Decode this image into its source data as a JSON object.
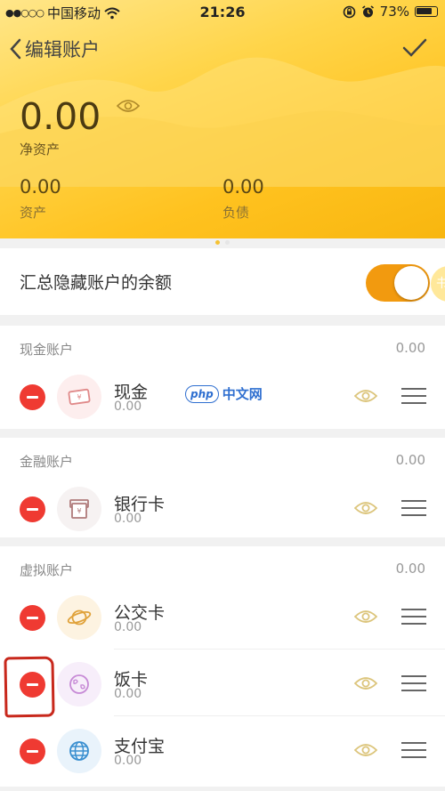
{
  "status_bar": {
    "signal": "●●○○○",
    "carrier": "中国移动",
    "time": "21:26",
    "battery_pct": "73%"
  },
  "nav": {
    "title": "编辑账户"
  },
  "summary": {
    "net_assets_value": "0.00",
    "net_assets_label": "净资产",
    "assets_value": "0.00",
    "assets_label": "资产",
    "liabilities_value": "0.00",
    "liabilities_label": "负债",
    "page_count": 2,
    "active_page": 1
  },
  "toggle": {
    "label": "汇总隐藏账户的余额",
    "on": true,
    "edge_tab_text": "书"
  },
  "sections": [
    {
      "title": "现金账户",
      "total": "0.00",
      "items": [
        {
          "name": "现金",
          "value": "0.00",
          "icon": "cash-icon",
          "icon_color": "#e08a8a",
          "icon_bg": "#fdeeee"
        }
      ]
    },
    {
      "title": "金融账户",
      "total": "0.00",
      "items": [
        {
          "name": "银行卡",
          "value": "0.00",
          "icon": "bank-card-icon",
          "icon_color": "#b07b7b",
          "icon_bg": "#f6f2f2"
        }
      ]
    },
    {
      "title": "虚拟账户",
      "total": "0.00",
      "items": [
        {
          "name": "公交卡",
          "value": "0.00",
          "icon": "planet-icon",
          "icon_color": "#e0a23a",
          "icon_bg": "#fdf3e1"
        },
        {
          "name": "饭卡",
          "value": "0.00",
          "icon": "globe-icon",
          "icon_color": "#c78ad6",
          "icon_bg": "#f7eefa"
        },
        {
          "name": "支付宝",
          "value": "0.00",
          "icon": "web-globe-icon",
          "icon_color": "#3a8fd0",
          "icon_bg": "#e9f3fb"
        }
      ]
    }
  ],
  "watermark": {
    "badge": "php",
    "text": "中文网"
  },
  "colors": {
    "accent": "#f29a0f",
    "delete": "#ef3a32",
    "eye": "#dcc57c",
    "header": "#ffc21f"
  }
}
